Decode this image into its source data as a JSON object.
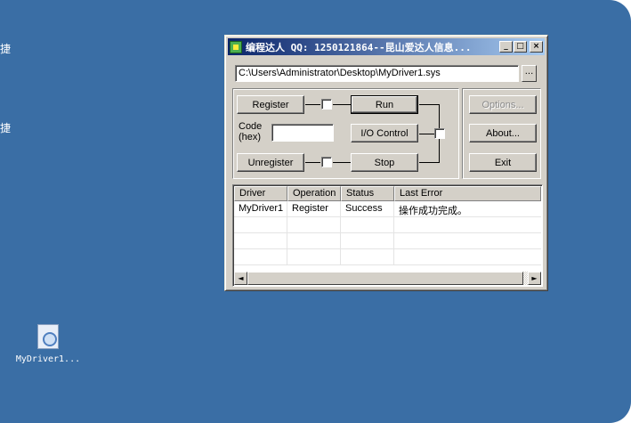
{
  "desktop": {
    "fragments": [
      "捷",
      "捷"
    ],
    "icon_label": "MyDriver1..."
  },
  "window": {
    "title": "编程达人 QQ: 1250121864--昆山爱达人信息...",
    "controls": {
      "minimize": "_",
      "maximize": "□",
      "close": "×"
    },
    "path_value": "C:\\Users\\Administrator\\Desktop\\MyDriver1.sys",
    "browse_label": "...",
    "buttons": {
      "register": "Register",
      "unregister": "Unregister",
      "run": "Run",
      "io_control": "I/O Control",
      "stop": "Stop",
      "options": "Options...",
      "about": "About...",
      "exit": "Exit"
    },
    "code_label_line1": "Code",
    "code_label_line2": "(hex)",
    "code_value": "",
    "list": {
      "columns": [
        "Driver",
        "Operation",
        "Status",
        "Last Error"
      ],
      "rows": [
        [
          "MyDriver1",
          "Register",
          "Success",
          "操作成功完成。"
        ]
      ]
    },
    "scrollbar": {
      "left": "◄",
      "right": "►"
    }
  }
}
